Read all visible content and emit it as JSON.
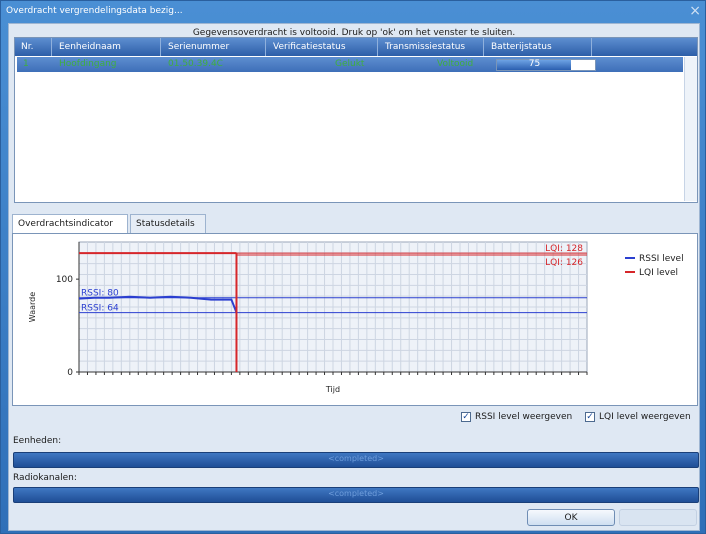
{
  "window": {
    "title": "Overdracht vergrendelingsdata bezig...",
    "close_glyph": "×",
    "message": "Gegevensoverdracht is voltooid. Druk op 'ok' om het venster te sluiten."
  },
  "grid": {
    "columns": [
      "Nr.",
      "Eenheidnaam",
      "Serienummer",
      "Verificatiestatus",
      "Transmissiestatus",
      "Batterijstatus"
    ],
    "rows": [
      {
        "nr": "1",
        "name": "Hoofdingang",
        "serial": "01.50.39.4C",
        "verification": "Gelukt",
        "transmission": "Voltooid",
        "battery": "75",
        "battery_percent": 75
      }
    ]
  },
  "tabs": [
    {
      "label": "Overdrachtsindicator",
      "active": true
    },
    {
      "label": "Statusdetails",
      "active": false
    }
  ],
  "checkboxes": [
    {
      "label": "RSSI level weergeven",
      "checked": true
    },
    {
      "label": "LQI level weergeven",
      "checked": true
    }
  ],
  "sections": {
    "units_label": "Eenheden:",
    "units_status": "<completed>",
    "radio_label": "Radiokanalen:",
    "radio_status": "<completed>"
  },
  "buttons": {
    "ok": "OK"
  },
  "chart_data": {
    "type": "line",
    "ylabel": "Waarde",
    "xlabel": "Tijd",
    "yticks": [
      0,
      100
    ],
    "ylim": [
      0,
      140
    ],
    "xlim": [
      0,
      100
    ],
    "grid": true,
    "legend_position": "right",
    "series": [
      {
        "name": "RSSI level",
        "color": "#2b3fd0",
        "x": [
          0,
          3,
          6,
          10,
          14,
          18,
          22,
          26,
          30,
          31
        ],
        "y": [
          79,
          80,
          80,
          81,
          80,
          81,
          80,
          78,
          78,
          64
        ]
      },
      {
        "name": "LQI level",
        "color": "#d6262a",
        "x": [
          0,
          31
        ],
        "y": [
          128,
          128
        ]
      }
    ],
    "reference_lines": [
      {
        "label": "LQI: 128",
        "value": 128,
        "color": "#d6262a"
      },
      {
        "label": "LQI: 126",
        "value": 126,
        "color": "#d6262a"
      },
      {
        "label": "RSSI: 80",
        "value": 80,
        "color": "#2b3fd0"
      },
      {
        "label": "RSSI: 64",
        "value": 64,
        "color": "#2b3fd0"
      }
    ],
    "marker_x": 31
  }
}
